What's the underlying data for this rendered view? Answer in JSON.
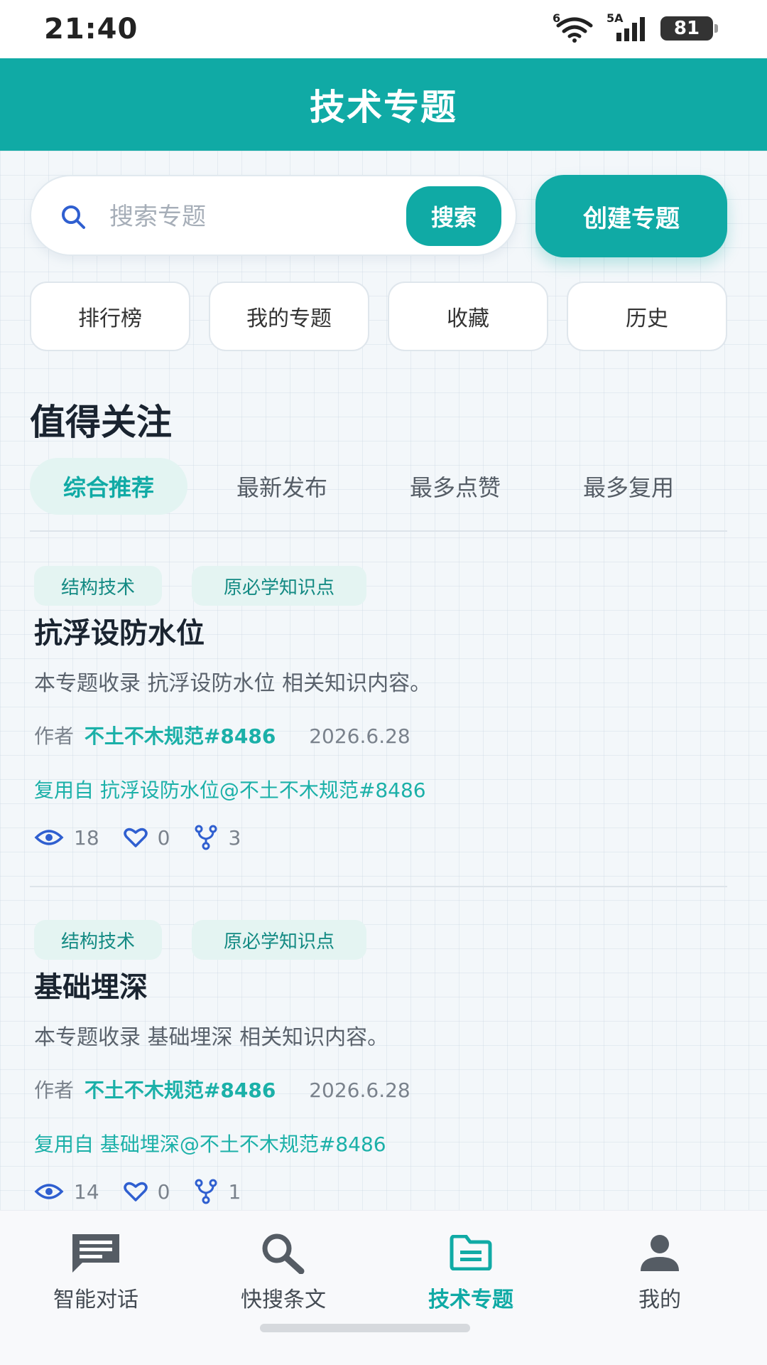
{
  "status_bar": {
    "time": "21:40",
    "wifi_tag": "6",
    "signal_tag": "5A",
    "battery": "81"
  },
  "header": {
    "title": "技术专题"
  },
  "search": {
    "placeholder": "搜索专题",
    "button_label": "搜索"
  },
  "create_button": "创建专题",
  "quick_actions": [
    "排行榜",
    "我的专题",
    "收藏",
    "历史"
  ],
  "section_title": "值得关注",
  "sort_tabs": [
    {
      "label": "综合推荐",
      "active": true
    },
    {
      "label": "最新发布",
      "active": false
    },
    {
      "label": "最多点赞",
      "active": false
    },
    {
      "label": "最多复用",
      "active": false
    }
  ],
  "topics": [
    {
      "tags": [
        "结构技术",
        "原必学知识点"
      ],
      "title": "抗浮设防水位",
      "description": "本专题收录 抗浮设防水位 相关知识内容。",
      "author_label": "作者",
      "author": "不土不木规范#8486",
      "date": "2026.6.28",
      "reuse_text": "复用自 抗浮设防水位@不土不木规范#8486",
      "views": "18",
      "likes": "0",
      "forks": "3"
    },
    {
      "tags": [
        "结构技术",
        "原必学知识点"
      ],
      "title": "基础埋深",
      "description": "本专题收录 基础埋深 相关知识内容。",
      "author_label": "作者",
      "author": "不土不木规范#8486",
      "date": "2026.6.28",
      "reuse_text": "复用自 基础埋深@不土不木规范#8486",
      "views": "14",
      "likes": "0",
      "forks": "1"
    }
  ],
  "bottom_nav": [
    {
      "label": "智能对话",
      "icon": "chat-icon",
      "active": false
    },
    {
      "label": "快搜条文",
      "icon": "search-icon",
      "active": false
    },
    {
      "label": "技术专题",
      "icon": "folder-icon",
      "active": true
    },
    {
      "label": "我的",
      "icon": "user-icon",
      "active": false
    }
  ],
  "colors": {
    "accent": "#10aaa5",
    "accent_light": "#e3f4f2",
    "icon_blue": "#2f5fd0"
  }
}
